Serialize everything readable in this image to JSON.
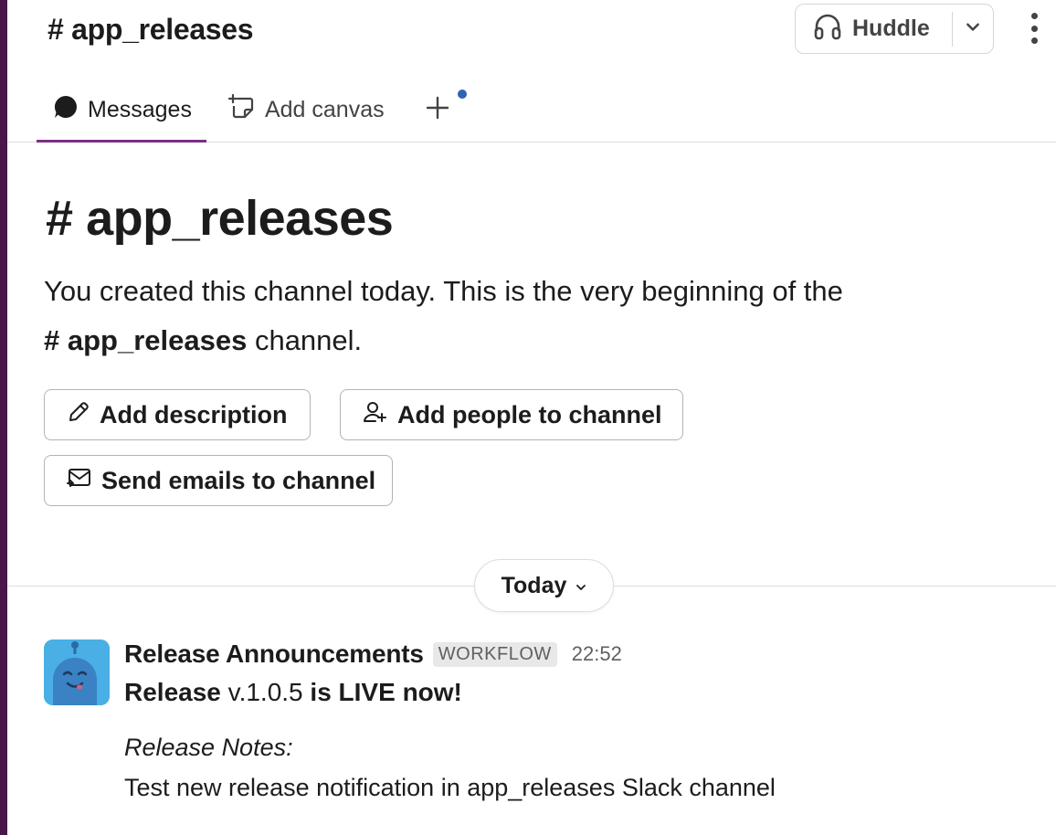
{
  "header": {
    "title": "# app_releases",
    "huddle_label": "Huddle"
  },
  "tabs": [
    {
      "label": "Messages",
      "icon": "speech-bubble-icon"
    },
    {
      "label": "Add canvas",
      "icon": "add-canvas-icon"
    }
  ],
  "intro": {
    "hash": "#",
    "title": "app_releases",
    "text_before": "You created this channel today. This is the very beginning of the",
    "channel_ref": "# app_releases",
    "text_after": "channel."
  },
  "actions": {
    "add_description": "Add description",
    "add_people": "Add people to channel",
    "send_emails": "Send emails to channel"
  },
  "date_divider": "Today",
  "message": {
    "sender": "Release Announcements",
    "badge": "WORKFLOW",
    "time": "22:52",
    "line1_bold_a": "Release",
    "line1_version": "v.1.0.5",
    "line1_bold_b": "is LIVE now!",
    "notes_label": "Release Notes:",
    "notes_text": "Test new release notification in app_releases Slack channel"
  },
  "colors": {
    "sidebar": "#4a154b",
    "active_tab_underline": "#7c3085",
    "notification_dot": "#2d64b3",
    "avatar_bg": "#49afe4"
  }
}
